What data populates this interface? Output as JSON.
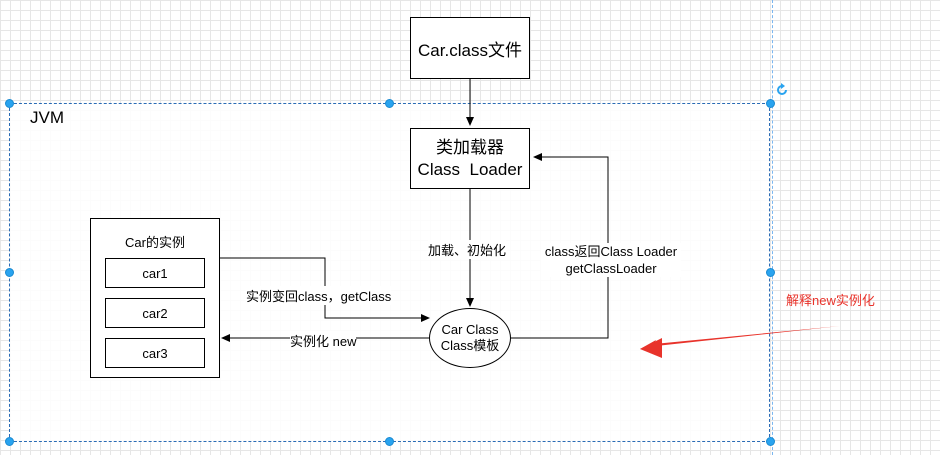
{
  "diagram": {
    "car_class_file": "Car.class文件",
    "jvm_label": "JVM",
    "class_loader": {
      "line1": "类加载器",
      "line2": "Class  Loader"
    },
    "car_instance_box": {
      "title": "Car的实例",
      "items": [
        "car1",
        "car2",
        "car3"
      ]
    },
    "template": {
      "line1": "Car Class",
      "line2": "Class模板"
    },
    "edges": {
      "load_init": "加载、初始化",
      "class_return": {
        "line1": "class返回Class Loader",
        "line2": "getClassLoader"
      },
      "instance_to_class": "实例变回class，getClass",
      "instantiate": "实例化 new"
    },
    "annotation": "解释new实例化",
    "colors": {
      "selection": "#29a3ef",
      "annotation": "#e8332b",
      "line": "#000000"
    },
    "icons": {
      "rotate": "rotate-icon"
    }
  }
}
